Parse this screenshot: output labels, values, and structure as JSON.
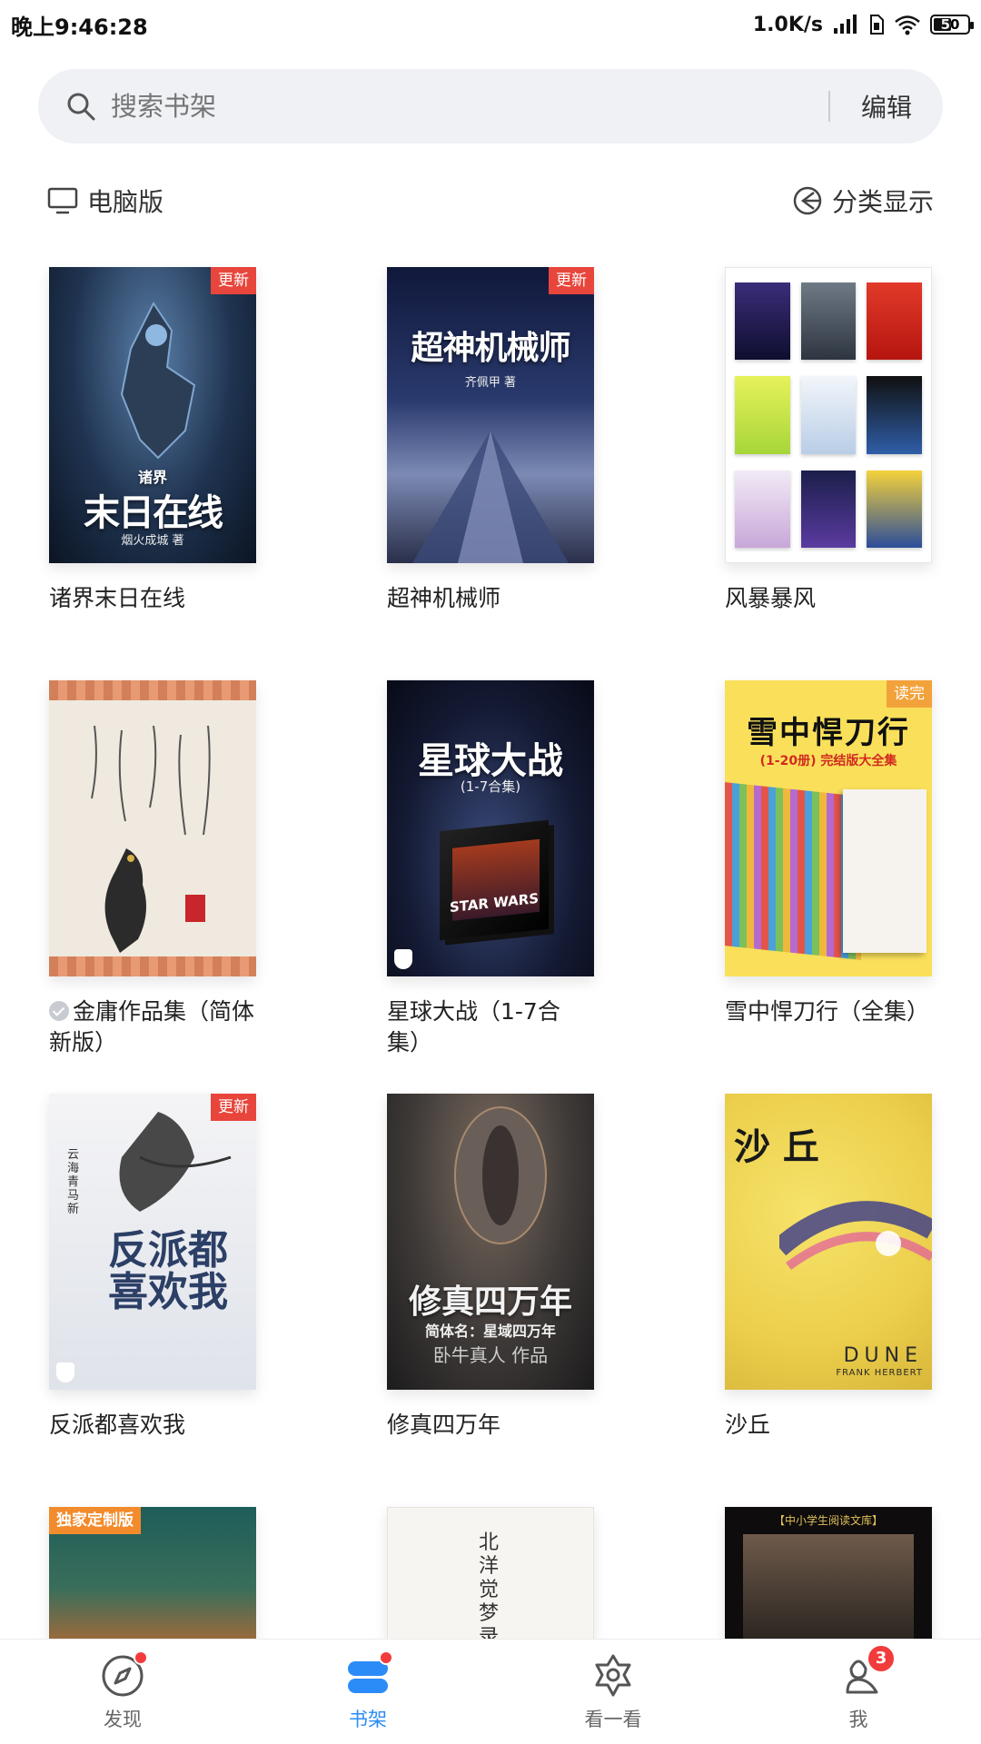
{
  "status_bar": {
    "time": "晚上9:46:28",
    "speed": "1.0K/s",
    "battery": "50"
  },
  "search": {
    "placeholder": "搜索书架",
    "edit_label": "编辑"
  },
  "toolbar": {
    "pc_label": "电脑版",
    "category_label": "分类显示"
  },
  "books": [
    {
      "title": "诸界末日在线",
      "badge": "更新",
      "cover_text": "末日在线",
      "cover_top": "诸界",
      "cover_author": "烟火成城 著"
    },
    {
      "title": "超神机械师",
      "badge": "更新",
      "cover_text": "超神机械师",
      "cover_author": "齐佩甲 著"
    },
    {
      "title": "风暴暴风",
      "badge": ""
    },
    {
      "title": "金庸作品集（简体新版）",
      "badge": ""
    },
    {
      "title": "星球大战（1-7合集）",
      "badge": "",
      "cover_text": "星球大战",
      "cover_sub": "(1-7合集)",
      "cover_box": "STAR WARS"
    },
    {
      "title": "雪中悍刀行（全集）",
      "badge": "读完",
      "cover_text": "雪中悍刀行",
      "cover_sub": "(1-20册) 完结版大全集"
    },
    {
      "title": "反派都喜欢我",
      "badge": "更新",
      "cover_text": "反派都喜欢我",
      "cover_author": "云海青马 新"
    },
    {
      "title": "修真四万年",
      "badge": "",
      "cover_text": "修真四万年",
      "cover_sub": "简体名：星域四万年",
      "cover_author": "卧牛真人 作品"
    },
    {
      "title": "沙丘",
      "badge": "",
      "cover_text": "沙 丘",
      "cover_sub": "DUNE",
      "cover_author": "FRANK HERBERT"
    },
    {
      "title": "",
      "badge": "独家定制版"
    },
    {
      "title": "",
      "badge": "",
      "cover_text": "北洋觉梦录"
    },
    {
      "title": "",
      "badge": "",
      "cover_sub": "【中小学生阅读文库】"
    }
  ],
  "nav": {
    "items": [
      {
        "label": "发现"
      },
      {
        "label": "书架"
      },
      {
        "label": "看一看"
      },
      {
        "label": "我",
        "count": "3"
      }
    ]
  },
  "colors": {
    "accent": "#2b8cf7",
    "badge_red": "#e8453c",
    "badge_orange": "#f2a23a",
    "notify_red": "#f23b3b"
  }
}
